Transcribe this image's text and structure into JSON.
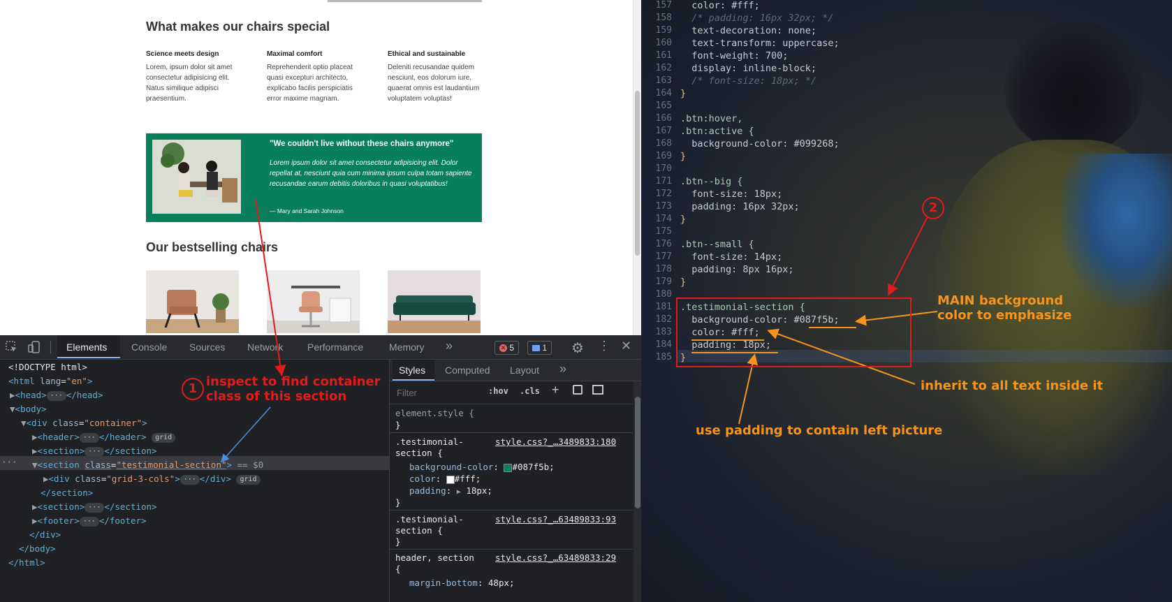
{
  "viewport": {
    "feature_heading": "What makes our chairs special",
    "features": [
      {
        "title": "Science meets design",
        "text": "Lorem, ipsum dolor sit amet consectetur adipisicing elit. Natus similique adipisci praesentium."
      },
      {
        "title": "Maximal comfort",
        "text": "Reprehenderit optio placeat quasi excepturi architecto, explicabo facilis perspiciatis error maxime magnam."
      },
      {
        "title": "Ethical and sustainable",
        "text": "Deleniti recusandae quidem nesciunt, eos dolorum iure, quaerat omnis est laudantium voluptatem voluptas!"
      }
    ],
    "testimonial": {
      "quote": "\"We couldn't live without these chairs anymore\"",
      "text": "Lorem ipsum dolor sit amet consectetur adipisicing elit. Dolor repellat at, nesciunt quia cum minima ipsum culpa totam sapiente recusandae earum debitis doloribus in quasi voluptatibus!",
      "author": "— Mary and Sarah Johnson",
      "bg_color": "#087f5b"
    },
    "bestselling_heading": "Our bestselling chairs"
  },
  "devtools": {
    "tabs": [
      "Elements",
      "Console",
      "Sources",
      "Network",
      "Performance",
      "Memory"
    ],
    "more": "»",
    "errors": "5",
    "messages": "1",
    "styles_tabs": [
      "Styles",
      "Computed",
      "Layout"
    ],
    "filter_placeholder": "Filter",
    "hov": ":hov",
    "cls": ".cls",
    "tree": {
      "doctype": "<!DOCTYPE html>",
      "html_open": "<html",
      "lang_attr": "lang",
      "lang_val": "\"en\"",
      "head": "<head>",
      "head_close": "</head>",
      "body": "<body>",
      "div_open": "<div",
      "class_attr": "class",
      "container_val": "\"container\"",
      "header": "<header>",
      "header_close": "</header>",
      "grid_badge": "grid",
      "section": "<section>",
      "section_close": "</section>",
      "section_open": "<section",
      "testimonial_val": "\"testimonial-section\"",
      "selected_suffix": "== $0",
      "grid3_val": "\"grid-3-cols\"",
      "div_close": "</div>",
      "footer": "<footer>",
      "footer_close": "</footer>",
      "body_close": "</body>",
      "html_close": "</html>"
    },
    "styles": {
      "element_style": "element.style {",
      "close": "}",
      "rule1_selector": ".testimonial-",
      "rule1_selector2": "section {",
      "rule1_link": "style.css?_…3489833:180",
      "rule1_props": [
        {
          "name": "background-color",
          "value": "#087f5b;",
          "swatch": "#087f5b"
        },
        {
          "name": "color",
          "value": "#fff;",
          "swatch": "#ffffff"
        },
        {
          "name": "padding",
          "value": "18px;",
          "swatch": ""
        }
      ],
      "rule2_link": "style.css?_…63489833:93",
      "rule3_selector": "header, section",
      "rule3_link": "style.css?_…63489833:29",
      "rule3_prop": "margin-bottom",
      "rule3_value": "48px;"
    }
  },
  "editor": {
    "lines": [
      {
        "n": "157",
        "code": "  color: #fff;"
      },
      {
        "n": "158",
        "code": "  /* padding: 16px 32px; */"
      },
      {
        "n": "159",
        "code": "  text-decoration: none;"
      },
      {
        "n": "160",
        "code": "  text-transform: uppercase;"
      },
      {
        "n": "161",
        "code": "  font-weight: 700;"
      },
      {
        "n": "162",
        "code": "  display: inline-block;"
      },
      {
        "n": "163",
        "code": "  /* font-size: 18px; */"
      },
      {
        "n": "164",
        "code": "}"
      },
      {
        "n": "165",
        "code": ""
      },
      {
        "n": "166",
        "code": ".btn:hover,"
      },
      {
        "n": "167",
        "code": ".btn:active {"
      },
      {
        "n": "168",
        "code": "  background-color: #099268;"
      },
      {
        "n": "169",
        "code": "}"
      },
      {
        "n": "170",
        "code": ""
      },
      {
        "n": "171",
        "code": ".btn--big {"
      },
      {
        "n": "172",
        "code": "  font-size: 18px;"
      },
      {
        "n": "173",
        "code": "  padding: 16px 32px;"
      },
      {
        "n": "174",
        "code": "}"
      },
      {
        "n": "175",
        "code": ""
      },
      {
        "n": "176",
        "code": ".btn--small {"
      },
      {
        "n": "177",
        "code": "  font-size: 14px;"
      },
      {
        "n": "178",
        "code": "  padding: 8px 16px;"
      },
      {
        "n": "179",
        "code": "}"
      },
      {
        "n": "180",
        "code": ""
      },
      {
        "n": "181",
        "code": ".testimonial-section {"
      },
      {
        "n": "182",
        "code": "  background-color: #087f5b;"
      },
      {
        "n": "183",
        "code": "  color: #fff;"
      },
      {
        "n": "184",
        "code": "  padding: 18px;"
      },
      {
        "n": "185",
        "code": "}"
      }
    ]
  },
  "annotations": {
    "step1_number": "1",
    "step1_text_line1": "inspect to find container",
    "step1_text_line2": "class of this section",
    "step2_number": "2",
    "main_bg_line1": "MAIN background",
    "main_bg_line2": "color to emphasize",
    "inherit": "inherit to all text inside it",
    "padding": "use padding to contain left picture"
  }
}
